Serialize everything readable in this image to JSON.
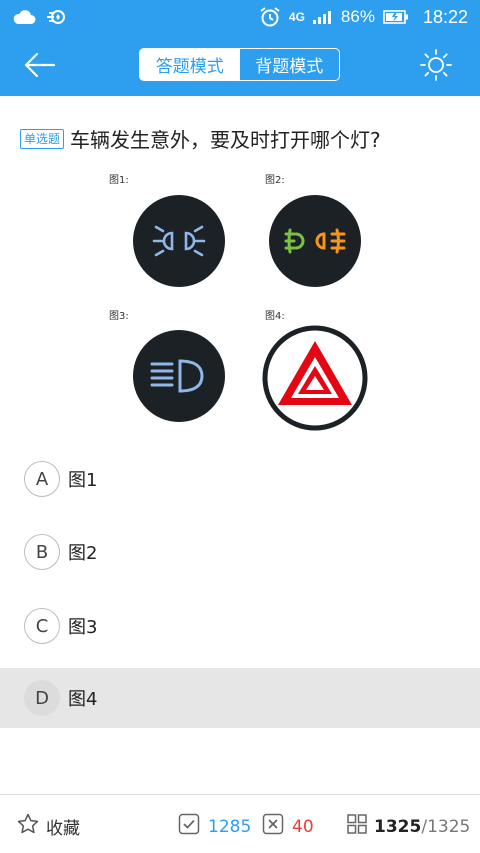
{
  "status_bar": {
    "network_label": "4G",
    "battery_percent": "86%",
    "time": "18:22"
  },
  "header": {
    "tabs": [
      {
        "label": "答题模式",
        "active": true
      },
      {
        "label": "背题模式",
        "active": false
      }
    ]
  },
  "question": {
    "type_label": "单选题",
    "text": "车辆发生意外，要及时打开哪个灯?",
    "figures": [
      {
        "label": "图1:",
        "icon": "parking-light-icon"
      },
      {
        "label": "图2:",
        "icon": "fog-light-icon"
      },
      {
        "label": "图3:",
        "icon": "high-beam-icon"
      },
      {
        "label": "图4:",
        "icon": "hazard-warning-icon"
      }
    ]
  },
  "options": [
    {
      "letter": "A",
      "text": "图1",
      "selected": false
    },
    {
      "letter": "B",
      "text": "图2",
      "selected": false
    },
    {
      "letter": "C",
      "text": "图3",
      "selected": false
    },
    {
      "letter": "D",
      "text": "图4",
      "selected": true
    }
  ],
  "bottom_bar": {
    "favorite_label": "收藏",
    "correct_count": "1285",
    "wrong_count": "40",
    "progress_current": "1325",
    "progress_separator": "/",
    "progress_total": "1325"
  },
  "colors": {
    "accent": "#2d9fee",
    "wrong": "#e0443c",
    "hazard_red": "#e30613"
  }
}
